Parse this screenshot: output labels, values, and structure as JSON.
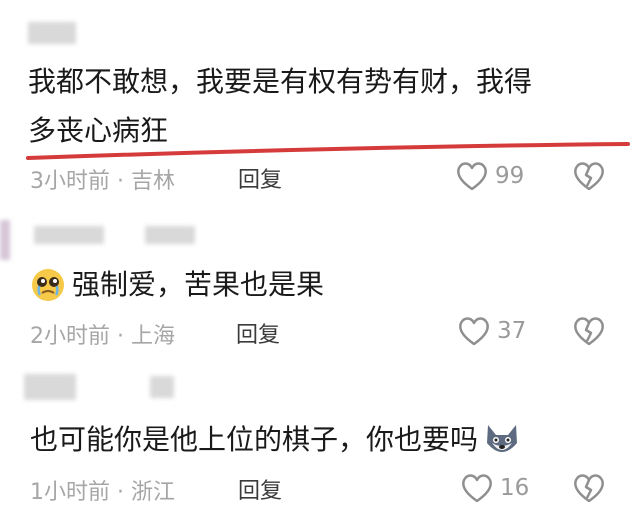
{
  "comments": [
    {
      "text_line1": "我都不敢想，我要是有权有势有财，我得",
      "text_line2": "多丧心病狂",
      "time": "3小时前",
      "location": "吉林",
      "reply": "回复",
      "likes": "99"
    },
    {
      "text": "强制爱，苦果也是果",
      "time": "2小时前",
      "location": "上海",
      "reply": "回复",
      "likes": "37"
    },
    {
      "text": "也可能你是他上位的棋子，你也要吗",
      "time": "1小时前",
      "location": "浙江",
      "reply": "回复",
      "likes": "16"
    }
  ],
  "separator": "·",
  "colors": {
    "underline": "#d63b3b",
    "meta_gray": "#a6a6a6",
    "icon_gray": "#8f8f8f"
  },
  "icons": [
    "heart-outline-icon",
    "broken-heart-icon",
    "pleading-face-emoji",
    "wolf-face-emoji"
  ]
}
